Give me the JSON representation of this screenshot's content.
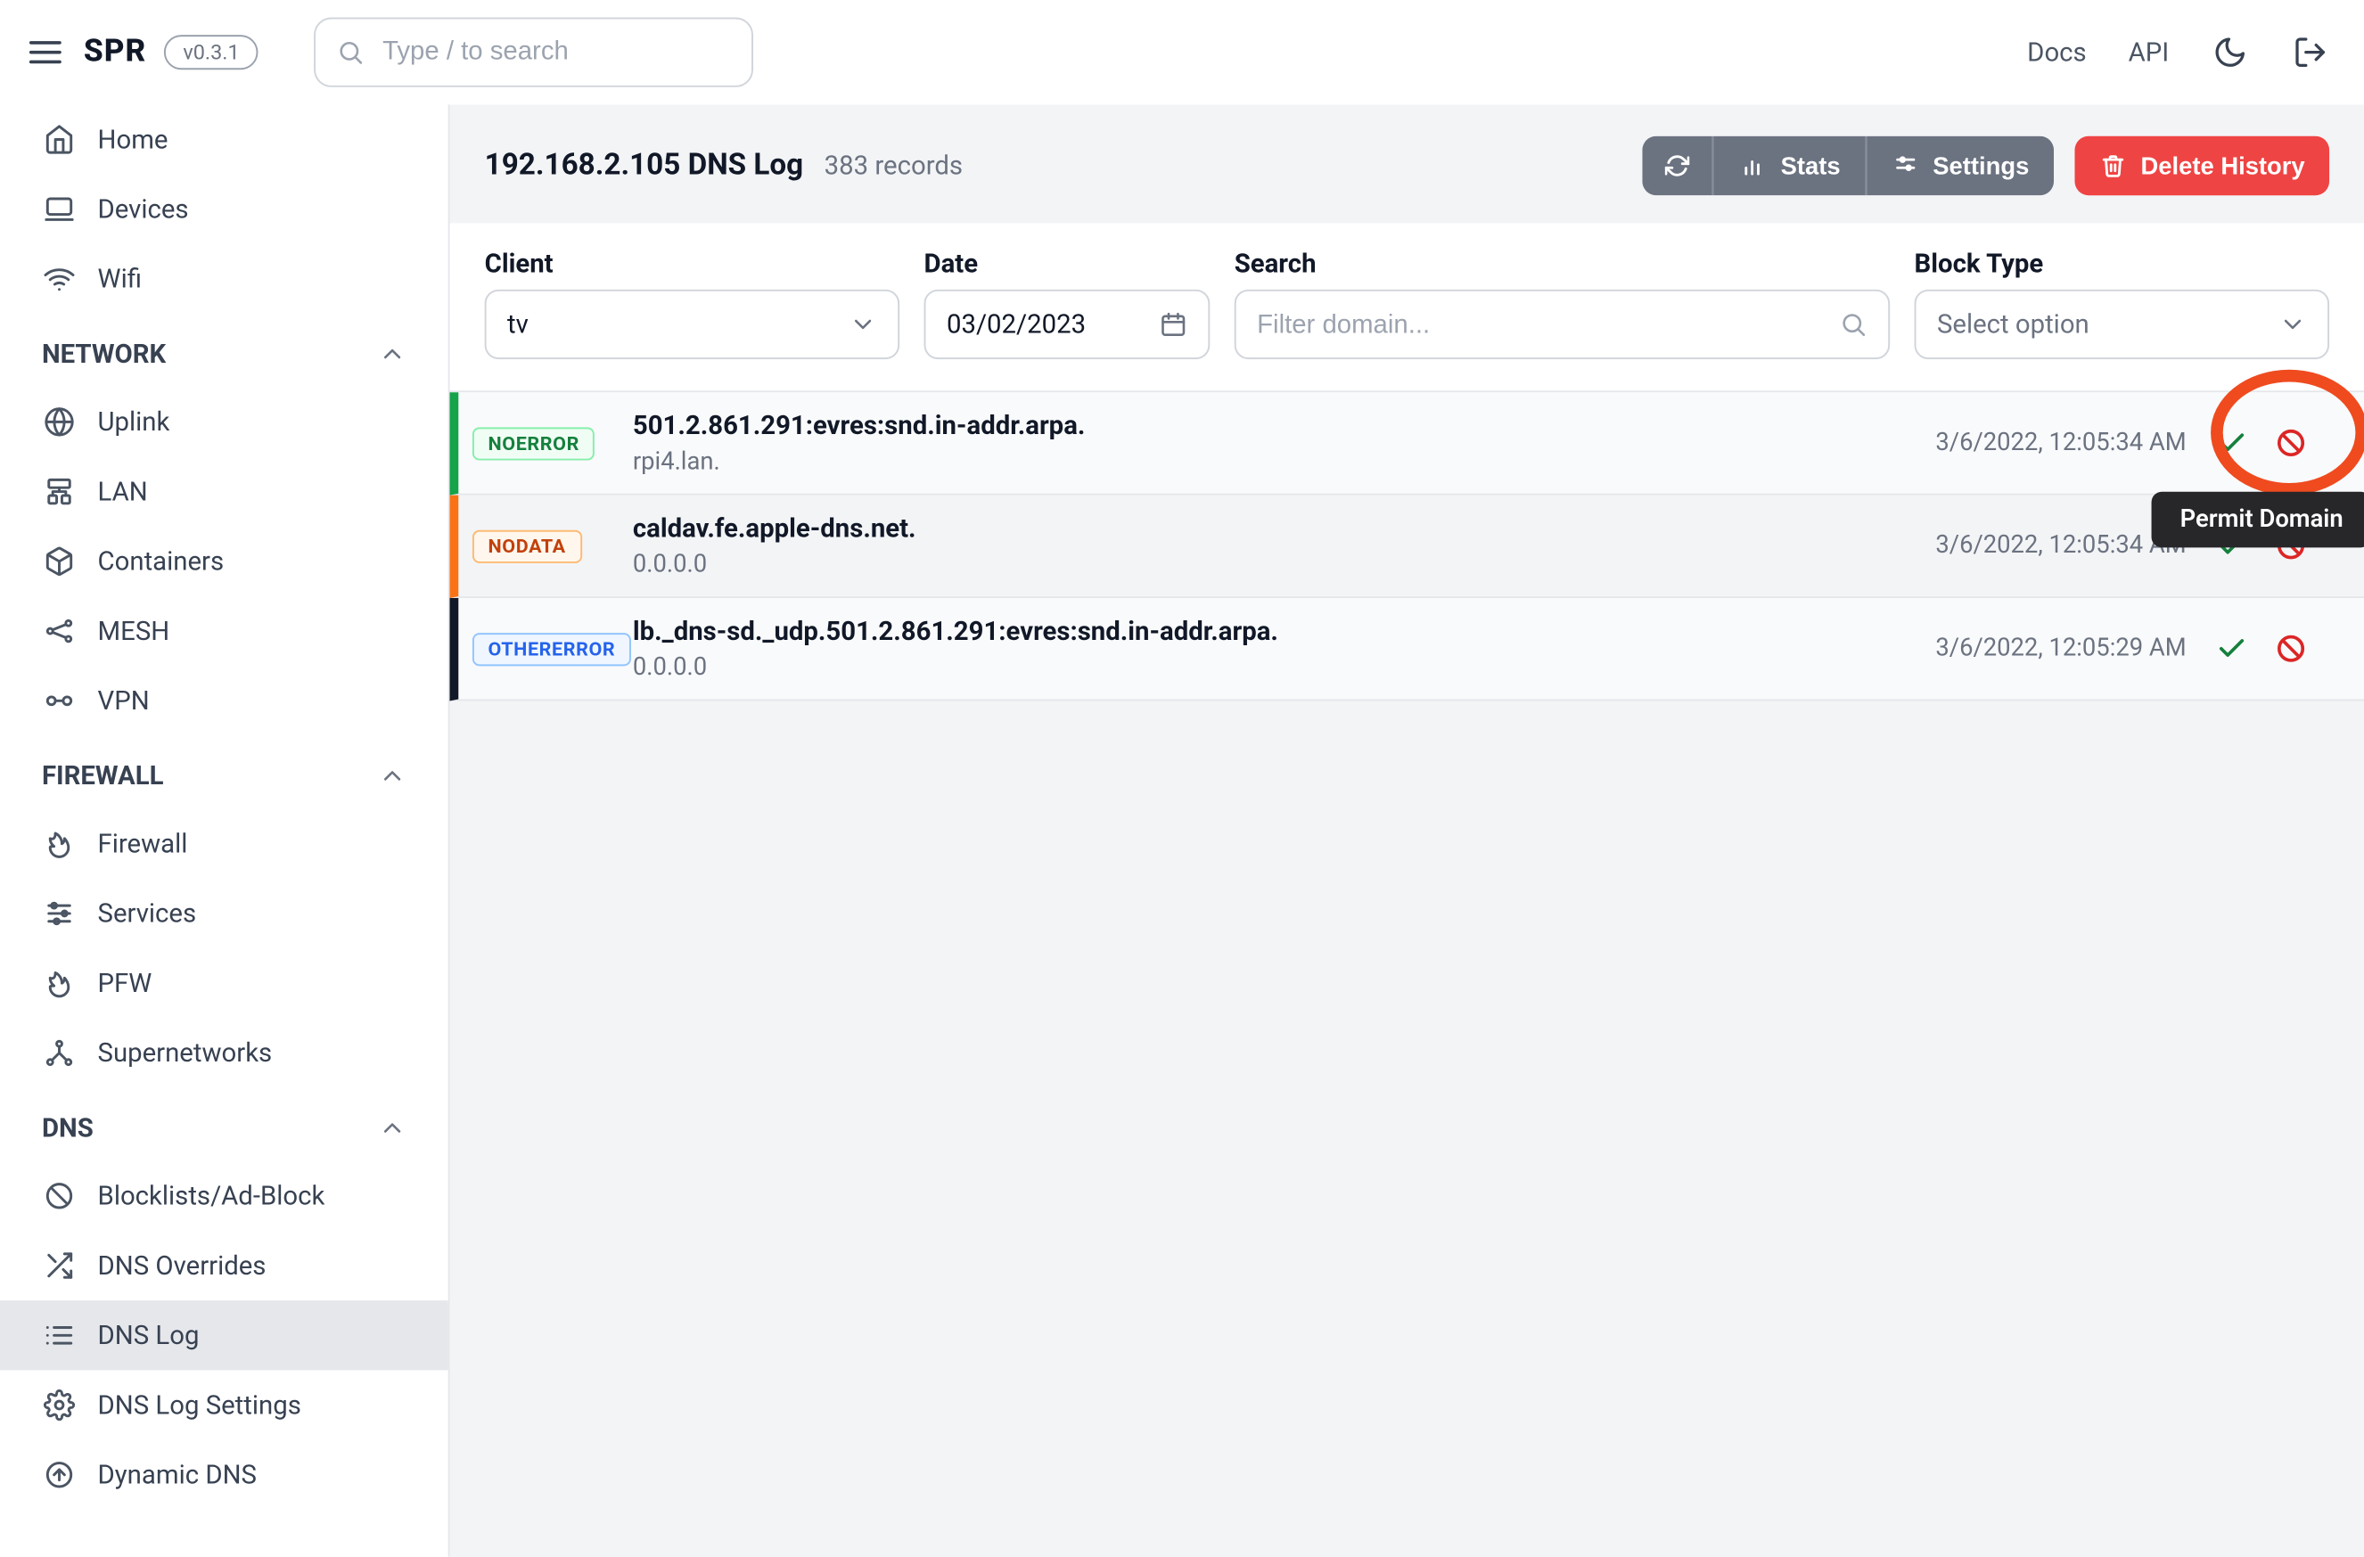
{
  "header": {
    "brand": "SPR",
    "version": "v0.3.1",
    "search_placeholder": "Type / to search",
    "links": {
      "docs": "Docs",
      "api": "API"
    }
  },
  "sidebar": {
    "top": [
      {
        "label": "Home"
      },
      {
        "label": "Devices"
      },
      {
        "label": "Wifi"
      }
    ],
    "sections": [
      {
        "title": "NETWORK",
        "items": [
          {
            "label": "Uplink"
          },
          {
            "label": "LAN"
          },
          {
            "label": "Containers"
          },
          {
            "label": "MESH"
          },
          {
            "label": "VPN"
          }
        ]
      },
      {
        "title": "FIREWALL",
        "items": [
          {
            "label": "Firewall"
          },
          {
            "label": "Services"
          },
          {
            "label": "PFW"
          },
          {
            "label": "Supernetworks"
          }
        ]
      },
      {
        "title": "DNS",
        "items": [
          {
            "label": "Blocklists/Ad-Block"
          },
          {
            "label": "DNS Overrides"
          },
          {
            "label": "DNS Log"
          },
          {
            "label": "DNS Log Settings"
          },
          {
            "label": "Dynamic DNS"
          }
        ]
      }
    ],
    "active_label": "DNS Log"
  },
  "page": {
    "title": "192.168.2.105 DNS Log",
    "subtitle": "383 records",
    "actions": {
      "stats": "Stats",
      "settings": "Settings",
      "delete": "Delete History"
    }
  },
  "filters": {
    "client": {
      "label": "Client",
      "value": "tv"
    },
    "date": {
      "label": "Date",
      "value": "03/02/2023"
    },
    "search": {
      "label": "Search",
      "placeholder": "Filter domain..."
    },
    "blocktype": {
      "label": "Block Type",
      "placeholder": "Select option"
    }
  },
  "records": [
    {
      "status": "NOERROR",
      "status_color": "green",
      "accent": "#16a34a",
      "domain": "501.2.861.291:evres:snd.in-addr.arpa.",
      "answer": "rpi4.lan.",
      "time": "3/6/2022, 12:05:34 AM"
    },
    {
      "status": "NODATA",
      "status_color": "orange",
      "accent": "#f97316",
      "domain": "caldav.fe.apple-dns.net.",
      "answer": "0.0.0.0",
      "time": "3/6/2022, 12:05:34 AM"
    },
    {
      "status": "OTHERERROR",
      "status_color": "gray",
      "accent": "#111827",
      "domain": "lb._dns-sd._udp.501.2.861.291:evres:snd.in-addr.arpa.",
      "answer": "0.0.0.0",
      "time": "3/6/2022, 12:05:29 AM"
    }
  ],
  "tooltip": "Permit Domain"
}
